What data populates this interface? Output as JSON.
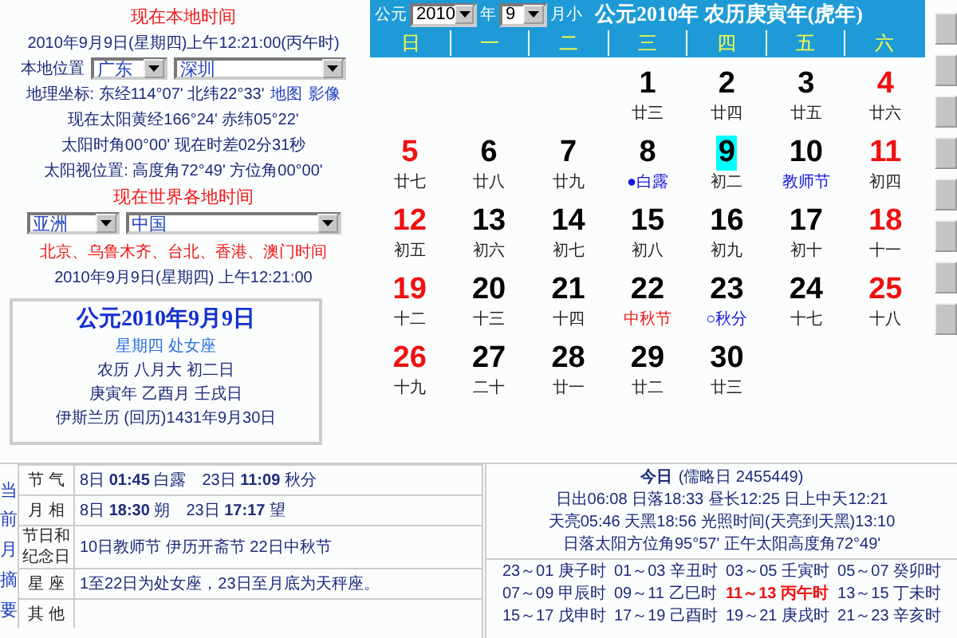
{
  "local_time": {
    "title": "现在本地时间",
    "datetime": "2010年9月9日(星期四)上午12:21:00(丙午时)"
  },
  "location": {
    "label": "本地位置",
    "province": "广东",
    "city": "深圳"
  },
  "coords": {
    "text": "地理坐标: 东经114°07' 北纬22°33'",
    "links": [
      "地图",
      "影像"
    ]
  },
  "sun_lines": [
    "现在太阳黄经166°24' 赤纬05°22'",
    "太阳时角00°00' 现在时差02分31秒",
    "太阳视位置: 高度角72°49' 方位角00°00'"
  ],
  "world_time": {
    "title": "现在世界各地时间",
    "continent": "亚洲",
    "country": "中国",
    "cities": "北京、乌鲁木齐、台北、香港、澳门时间",
    "datetime": "2010年9月9日(星期四) 上午12:21:00"
  },
  "date_card": {
    "title": "公元2010年9月9日",
    "weekday": "星期四 处女座",
    "lunar": "农历 八月大 初二日",
    "ganzhi": "庚寅年 乙酉月 壬戌日",
    "islamic": "伊斯兰历 (回历)1431年9月30日"
  },
  "calendar": {
    "era_label": "公元",
    "year": "2010",
    "year_label": "年",
    "month": "9",
    "month_label": "月小",
    "title": "公元2010年 农历庚寅年(虎年)",
    "weekdays": [
      "日",
      "一",
      "二",
      "三",
      "四",
      "五",
      "六"
    ],
    "weeks": [
      {
        "days": [
          {
            "kind": "blank"
          },
          {
            "kind": "blank"
          },
          {
            "kind": "blank"
          },
          {
            "kind": "day",
            "number": "1",
            "note": {
              "text": "廿三",
              "kind": "lunar"
            },
            "selected": false
          },
          {
            "kind": "day",
            "number": "2",
            "note": {
              "text": "廿四",
              "kind": "lunar"
            },
            "selected": false
          },
          {
            "kind": "day",
            "number": "3",
            "note": {
              "text": "廿五",
              "kind": "lunar"
            },
            "selected": false
          },
          {
            "kind": "day",
            "number": "4",
            "note": {
              "text": "廿六",
              "kind": "lunar"
            },
            "selected": false
          }
        ]
      },
      {
        "days": [
          {
            "kind": "day",
            "number": "5",
            "note": {
              "text": "廿七",
              "kind": "lunar"
            },
            "selected": false
          },
          {
            "kind": "day",
            "number": "6",
            "note": {
              "text": "廿八",
              "kind": "lunar"
            },
            "selected": false
          },
          {
            "kind": "day",
            "number": "7",
            "note": {
              "text": "廿九",
              "kind": "lunar"
            },
            "selected": false
          },
          {
            "kind": "day",
            "number": "8",
            "note": {
              "text": "●白露",
              "kind": "term"
            },
            "selected": false
          },
          {
            "kind": "day",
            "number": "9",
            "note": {
              "text": "初二",
              "kind": "lunar"
            },
            "selected": true
          },
          {
            "kind": "day",
            "number": "10",
            "note": {
              "text": "教师节",
              "kind": "memorial"
            },
            "selected": false
          },
          {
            "kind": "day",
            "number": "11",
            "note": {
              "text": "初四",
              "kind": "lunar"
            },
            "selected": false
          }
        ]
      },
      {
        "days": [
          {
            "kind": "day",
            "number": "12",
            "note": {
              "text": "初五",
              "kind": "lunar"
            },
            "selected": false
          },
          {
            "kind": "day",
            "number": "13",
            "note": {
              "text": "初六",
              "kind": "lunar"
            },
            "selected": false
          },
          {
            "kind": "day",
            "number": "14",
            "note": {
              "text": "初七",
              "kind": "lunar"
            },
            "selected": false
          },
          {
            "kind": "day",
            "number": "15",
            "note": {
              "text": "初八",
              "kind": "lunar"
            },
            "selected": false
          },
          {
            "kind": "day",
            "number": "16",
            "note": {
              "text": "初九",
              "kind": "lunar"
            },
            "selected": false
          },
          {
            "kind": "day",
            "number": "17",
            "note": {
              "text": "初十",
              "kind": "lunar"
            },
            "selected": false
          },
          {
            "kind": "day",
            "number": "18",
            "note": {
              "text": "十一",
              "kind": "lunar"
            },
            "selected": false
          }
        ]
      },
      {
        "days": [
          {
            "kind": "day",
            "number": "19",
            "note": {
              "text": "十二",
              "kind": "lunar"
            },
            "selected": false
          },
          {
            "kind": "day",
            "number": "20",
            "note": {
              "text": "十三",
              "kind": "lunar"
            },
            "selected": false
          },
          {
            "kind": "day",
            "number": "21",
            "note": {
              "text": "十四",
              "kind": "lunar"
            },
            "selected": false
          },
          {
            "kind": "day",
            "number": "22",
            "note": {
              "text": "中秋节",
              "kind": "festival"
            },
            "selected": false
          },
          {
            "kind": "day",
            "number": "23",
            "note": {
              "text": "○秋分",
              "kind": "term"
            },
            "selected": false
          },
          {
            "kind": "day",
            "number": "24",
            "note": {
              "text": "十七",
              "kind": "lunar"
            },
            "selected": false
          },
          {
            "kind": "day",
            "number": "25",
            "note": {
              "text": "十八",
              "kind": "lunar"
            },
            "selected": false
          }
        ]
      },
      {
        "days": [
          {
            "kind": "day",
            "number": "26",
            "note": {
              "text": "十九",
              "kind": "lunar"
            },
            "selected": false
          },
          {
            "kind": "day",
            "number": "27",
            "note": {
              "text": "二十",
              "kind": "lunar"
            },
            "selected": false
          },
          {
            "kind": "day",
            "number": "28",
            "note": {
              "text": "廿一",
              "kind": "lunar"
            },
            "selected": false
          },
          {
            "kind": "day",
            "number": "29",
            "note": {
              "text": "廿二",
              "kind": "lunar"
            },
            "selected": false
          },
          {
            "kind": "day",
            "number": "30",
            "note": {
              "text": "廿三",
              "kind": "lunar"
            },
            "selected": false
          }
        ]
      }
    ]
  },
  "summary": {
    "side_label": "当前月摘要",
    "rows": [
      {
        "label": "节 气",
        "value": "8日 **01:45** 白露　23日 **11:09** 秋分"
      },
      {
        "label": "月 相",
        "value": "8日 **18:30** 朔　23日 **17:17** 望"
      },
      {
        "label": "节日和纪念日",
        "value": "10日教师节 伊历开斋节 22日中秋节"
      },
      {
        "label": "星 座",
        "value": "1至22日为处女座，23日至月底为天秤座。"
      },
      {
        "label": "其 他"
      }
    ]
  },
  "today": {
    "title": "今日",
    "julian": "(儒略日 2455449)",
    "lines": [
      "日出06:08 日落18:33 昼长12:25 日上中天12:21",
      "天亮05:46 天黑18:56 光照时间(天亮到天黑)13:10",
      "日落太阳方位角95°57' 正午太阳高度角72°49'"
    ],
    "hours": [
      {
        "text": "23～01 庚子时",
        "current": false
      },
      {
        "text": "01～03 辛丑时",
        "current": false
      },
      {
        "text": "03～05 壬寅时",
        "current": false
      },
      {
        "text": "05～07 癸卯时",
        "current": false
      },
      {
        "text": "07～09 甲辰时",
        "current": false
      },
      {
        "text": "09～11 乙巳时",
        "current": false
      },
      {
        "text": "11～13 丙午时",
        "current": true
      },
      {
        "text": "13～15 丁未时",
        "current": false
      },
      {
        "text": "15～17 戊申时",
        "current": false
      },
      {
        "text": "17～19 己酉时",
        "current": false
      },
      {
        "text": "19～21 庚戌时",
        "current": false
      },
      {
        "text": "21～23 辛亥时",
        "current": false
      }
    ]
  }
}
